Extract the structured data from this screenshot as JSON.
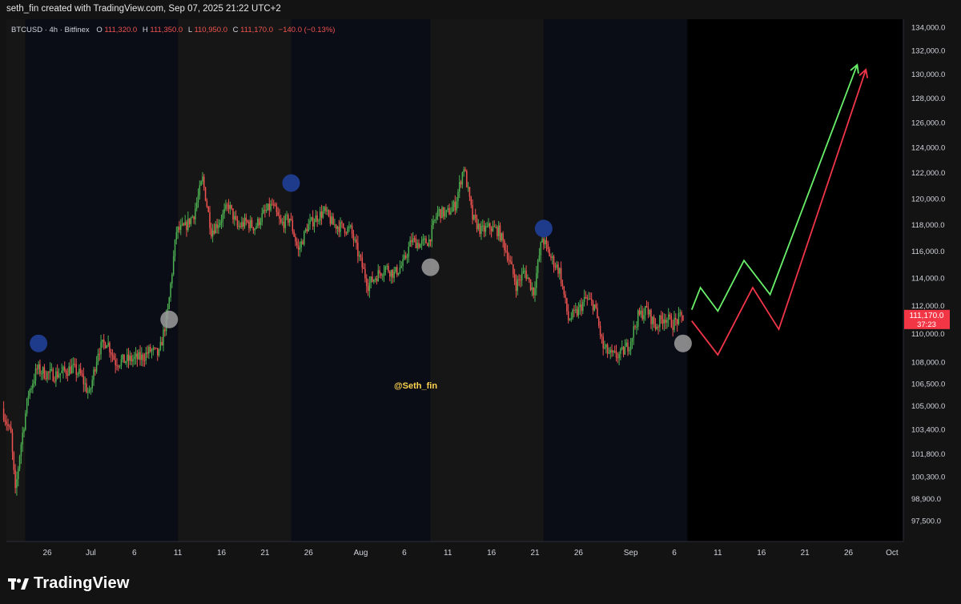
{
  "header": {
    "text": "seth_fin created with TradingView.com, Sep 07, 2025 21:22 UTC+2"
  },
  "footer": {
    "brand": "TradingView"
  },
  "colors": {
    "up": "#26a69a",
    "up_candle": "#4caf50",
    "down": "#ef5350",
    "bg_dark": "#0a0d16",
    "bg_gray": "#161616",
    "bg_future": "#000000",
    "marker_blue": "#1e3a8a",
    "marker_gray": "#9e9e9e",
    "arrow_green": "#69f06b",
    "arrow_red": "#f2364a",
    "price_label": "#f23645",
    "watermark": "#ffd54f"
  },
  "chart_data": {
    "type": "candlestick",
    "symbol_line": {
      "symbol": "BTCUSD · 4h · Bitfinex",
      "o_label": "O",
      "o_value": "111,320.0",
      "h_label": "H",
      "h_value": "111,350.0",
      "l_label": "L",
      "l_value": "110,950.0",
      "c_label": "C",
      "c_value": "111,170.0",
      "change": "−140.0 (−0.13%)"
    },
    "watermark": "@Seth_fin",
    "last_price": {
      "value": 111170,
      "label": "111,170.0",
      "countdown": "37:23"
    },
    "y_axis": {
      "scale": "log",
      "ticks": [
        {
          "v": 134000,
          "label": "134,000.0"
        },
        {
          "v": 132000,
          "label": "132,000.0"
        },
        {
          "v": 130000,
          "label": "130,000.0"
        },
        {
          "v": 128000,
          "label": "128,000.0"
        },
        {
          "v": 126000,
          "label": "126,000.0"
        },
        {
          "v": 124000,
          "label": "124,000.0"
        },
        {
          "v": 122000,
          "label": "122,000.0"
        },
        {
          "v": 120000,
          "label": "120,000.0"
        },
        {
          "v": 118000,
          "label": "118,000.0"
        },
        {
          "v": 116000,
          "label": "116,000.0"
        },
        {
          "v": 114000,
          "label": "114,000.0"
        },
        {
          "v": 112000,
          "label": "112,000.0"
        },
        {
          "v": 110000,
          "label": "110,000.0"
        },
        {
          "v": 108000,
          "label": "108,000.0"
        },
        {
          "v": 106500,
          "label": "106,500.0"
        },
        {
          "v": 105000,
          "label": "105,000.0"
        },
        {
          "v": 103400,
          "label": "103,400.0"
        },
        {
          "v": 101800,
          "label": "101,800.0"
        },
        {
          "v": 100300,
          "label": "100,300.0"
        },
        {
          "v": 98900,
          "label": "98,900.0"
        },
        {
          "v": 97500,
          "label": "97,500.0"
        }
      ]
    },
    "x_axis": {
      "ticks": [
        {
          "date": "2025-06-26",
          "label": "26"
        },
        {
          "date": "2025-07-01",
          "label": "Jul"
        },
        {
          "date": "2025-07-06",
          "label": "6"
        },
        {
          "date": "2025-07-11",
          "label": "11"
        },
        {
          "date": "2025-07-16",
          "label": "16"
        },
        {
          "date": "2025-07-21",
          "label": "21"
        },
        {
          "date": "2025-07-26",
          "label": "26"
        },
        {
          "date": "2025-08-01",
          "label": "Aug"
        },
        {
          "date": "2025-08-06",
          "label": "6"
        },
        {
          "date": "2025-08-11",
          "label": "11"
        },
        {
          "date": "2025-08-16",
          "label": "16"
        },
        {
          "date": "2025-08-21",
          "label": "21"
        },
        {
          "date": "2025-08-26",
          "label": "26"
        },
        {
          "date": "2025-09-01",
          "label": "Sep"
        },
        {
          "date": "2025-09-06",
          "label": "6"
        },
        {
          "date": "2025-09-11",
          "label": "11"
        },
        {
          "date": "2025-09-16",
          "label": "16"
        },
        {
          "date": "2025-09-21",
          "label": "21"
        },
        {
          "date": "2025-09-26",
          "label": "26"
        },
        {
          "date": "2025-10-01",
          "label": "Oct"
        }
      ]
    },
    "price_path": [
      {
        "date": "2025-06-21",
        "price": 104800
      },
      {
        "date": "2025-06-22",
        "price": 103000
      },
      {
        "date": "2025-06-22 12:00",
        "price": 99200
      },
      {
        "date": "2025-06-23",
        "price": 101800
      },
      {
        "date": "2025-06-24",
        "price": 105800
      },
      {
        "date": "2025-06-25",
        "price": 107500
      },
      {
        "date": "2025-06-26",
        "price": 107200
      },
      {
        "date": "2025-06-27",
        "price": 107100
      },
      {
        "date": "2025-06-28",
        "price": 107300
      },
      {
        "date": "2025-06-29",
        "price": 107600
      },
      {
        "date": "2025-06-30",
        "price": 107100
      },
      {
        "date": "2025-07-01",
        "price": 105700
      },
      {
        "date": "2025-07-02",
        "price": 108800
      },
      {
        "date": "2025-07-03",
        "price": 109500
      },
      {
        "date": "2025-07-04",
        "price": 108000
      },
      {
        "date": "2025-07-05",
        "price": 108100
      },
      {
        "date": "2025-07-06",
        "price": 108200
      },
      {
        "date": "2025-07-07",
        "price": 108300
      },
      {
        "date": "2025-07-08",
        "price": 108800
      },
      {
        "date": "2025-07-09",
        "price": 108500
      },
      {
        "date": "2025-07-10",
        "price": 111500
      },
      {
        "date": "2025-07-11",
        "price": 117500
      },
      {
        "date": "2025-07-12",
        "price": 117800
      },
      {
        "date": "2025-07-13",
        "price": 118800
      },
      {
        "date": "2025-07-14",
        "price": 121500
      },
      {
        "date": "2025-07-15",
        "price": 117500
      },
      {
        "date": "2025-07-16",
        "price": 118300
      },
      {
        "date": "2025-07-17",
        "price": 119500
      },
      {
        "date": "2025-07-18",
        "price": 117800
      },
      {
        "date": "2025-07-19",
        "price": 118200
      },
      {
        "date": "2025-07-20",
        "price": 117800
      },
      {
        "date": "2025-07-21",
        "price": 118800
      },
      {
        "date": "2025-07-22",
        "price": 119500
      },
      {
        "date": "2025-07-23",
        "price": 118000
      },
      {
        "date": "2025-07-24",
        "price": 118500
      },
      {
        "date": "2025-07-25",
        "price": 116000
      },
      {
        "date": "2025-07-26",
        "price": 117800
      },
      {
        "date": "2025-07-27",
        "price": 118500
      },
      {
        "date": "2025-07-28",
        "price": 119000
      },
      {
        "date": "2025-07-29",
        "price": 118000
      },
      {
        "date": "2025-07-30",
        "price": 117800
      },
      {
        "date": "2025-07-31",
        "price": 117600
      },
      {
        "date": "2025-08-01",
        "price": 115500
      },
      {
        "date": "2025-08-02",
        "price": 113500
      },
      {
        "date": "2025-08-03",
        "price": 114200
      },
      {
        "date": "2025-08-04",
        "price": 114800
      },
      {
        "date": "2025-08-05",
        "price": 114300
      },
      {
        "date": "2025-08-06",
        "price": 115000
      },
      {
        "date": "2025-08-07",
        "price": 116800
      },
      {
        "date": "2025-08-08",
        "price": 116500
      },
      {
        "date": "2025-08-09",
        "price": 116800
      },
      {
        "date": "2025-08-10",
        "price": 119000
      },
      {
        "date": "2025-08-11",
        "price": 118800
      },
      {
        "date": "2025-08-12",
        "price": 119500
      },
      {
        "date": "2025-08-13",
        "price": 122500
      },
      {
        "date": "2025-08-14",
        "price": 118500
      },
      {
        "date": "2025-08-15",
        "price": 117500
      },
      {
        "date": "2025-08-16",
        "price": 117800
      },
      {
        "date": "2025-08-17",
        "price": 117500
      },
      {
        "date": "2025-08-18",
        "price": 115800
      },
      {
        "date": "2025-08-19",
        "price": 113500
      },
      {
        "date": "2025-08-20",
        "price": 114500
      },
      {
        "date": "2025-08-21",
        "price": 113000
      },
      {
        "date": "2025-08-22",
        "price": 117000
      },
      {
        "date": "2025-08-23",
        "price": 115500
      },
      {
        "date": "2025-08-24",
        "price": 114500
      },
      {
        "date": "2025-08-25",
        "price": 111000
      },
      {
        "date": "2025-08-26",
        "price": 111500
      },
      {
        "date": "2025-08-27",
        "price": 112500
      },
      {
        "date": "2025-08-28",
        "price": 112000
      },
      {
        "date": "2025-08-29",
        "price": 109000
      },
      {
        "date": "2025-08-30",
        "price": 108400
      },
      {
        "date": "2025-08-31",
        "price": 108500
      },
      {
        "date": "2025-09-01",
        "price": 109300
      },
      {
        "date": "2025-09-02",
        "price": 111200
      },
      {
        "date": "2025-09-03",
        "price": 111700
      },
      {
        "date": "2025-09-04",
        "price": 110500
      },
      {
        "date": "2025-09-05",
        "price": 111200
      },
      {
        "date": "2025-09-06",
        "price": 110700
      },
      {
        "date": "2025-09-07",
        "price": 111170
      }
    ],
    "markers": [
      {
        "date": "2025-06-25",
        "price": 109300,
        "color": "blue"
      },
      {
        "date": "2025-07-10",
        "price": 111000,
        "color": "gray"
      },
      {
        "date": "2025-07-24",
        "price": 121200,
        "color": "blue"
      },
      {
        "date": "2025-08-09",
        "price": 114800,
        "color": "gray"
      },
      {
        "date": "2025-08-22",
        "price": 117700,
        "color": "blue"
      },
      {
        "date": "2025-09-07",
        "price": 109300,
        "color": "gray"
      }
    ],
    "projection_green": [
      {
        "date": "2025-09-08",
        "price": 111700
      },
      {
        "date": "2025-09-09",
        "price": 113300
      },
      {
        "date": "2025-09-11",
        "price": 111600
      },
      {
        "date": "2025-09-14",
        "price": 115300
      },
      {
        "date": "2025-09-17",
        "price": 112800
      },
      {
        "date": "2025-09-27",
        "price": 130800
      }
    ],
    "projection_red": [
      {
        "date": "2025-09-08",
        "price": 110900
      },
      {
        "date": "2025-09-11",
        "price": 108500
      },
      {
        "date": "2025-09-15",
        "price": 113300
      },
      {
        "date": "2025-09-18",
        "price": 110300
      },
      {
        "date": "2025-09-28",
        "price": 130400
      }
    ],
    "sessions": [
      {
        "start": "2025-06-21",
        "end": "2025-06-23 12:00",
        "shade": "gray"
      },
      {
        "start": "2025-06-23 12:00",
        "end": "2025-07-11",
        "shade": "dark"
      },
      {
        "start": "2025-07-11",
        "end": "2025-07-24",
        "shade": "gray"
      },
      {
        "start": "2025-07-24",
        "end": "2025-08-09",
        "shade": "dark"
      },
      {
        "start": "2025-08-09",
        "end": "2025-08-22",
        "shade": "gray"
      },
      {
        "start": "2025-08-22",
        "end": "2025-09-07 12:00",
        "shade": "dark"
      }
    ]
  }
}
